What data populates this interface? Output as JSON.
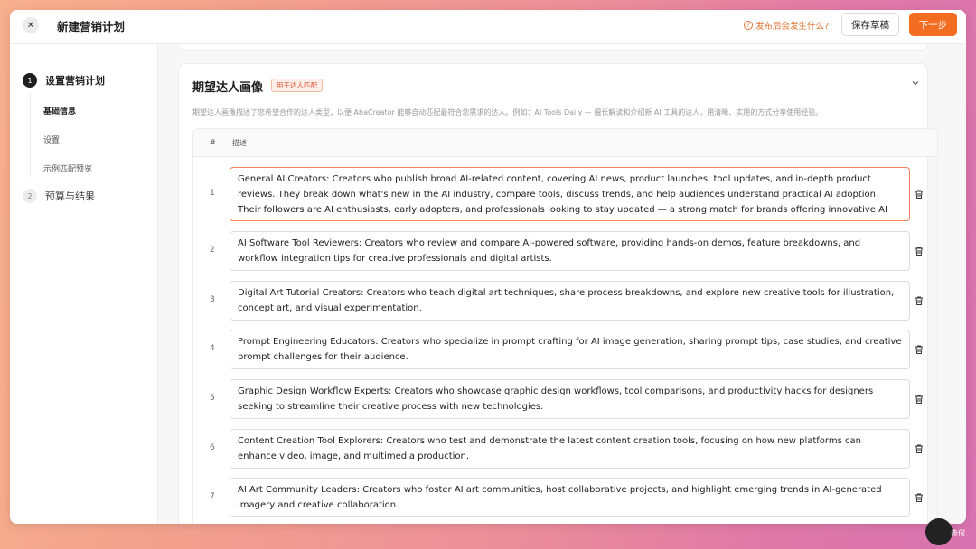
{
  "header": {
    "close_icon": "close-icon",
    "title": "新建营销计划",
    "help_text": "发布后会发生什么?",
    "save_label": "保存草稿",
    "next_label": "下一步",
    "accent_color": "#f26c22"
  },
  "sidebar": {
    "steps": [
      {
        "num": "1",
        "label": "设置营销计划",
        "state": "active"
      },
      {
        "num": "2",
        "label": "预算与结果",
        "state": "inactive"
      }
    ],
    "substeps": [
      {
        "label": "基础信息",
        "current": true
      },
      {
        "label": "设置",
        "current": false
      },
      {
        "label": "示例匹配预览",
        "current": false
      }
    ]
  },
  "section": {
    "title": "期望达人画像",
    "tag": "用于达人匹配",
    "description": "期望达人画像描述了您希望合作的达人类型，以便 AhaCreator 能够自动匹配最符合您需求的达人。例如：AI Tools Daily — 擅长解读和介绍新 AI 工具的达人，用清晰、实用的方式分享使用经验。",
    "table": {
      "col_index": "#",
      "col_desc": "描述",
      "rows": [
        {
          "index": "1",
          "text": "General AI Creators: Creators who publish broad AI-related content, covering AI news, product launches, tool updates, and in-depth product reviews. They break down what's new in the AI industry, compare tools, discuss trends, and help audiences understand practical AI adoption. Their followers are AI enthusiasts, early adopters, and professionals looking to stay updated — a strong match for brands offering innovative AI solutions."
        },
        {
          "index": "2",
          "text": "AI Software Tool Reviewers: Creators who review and compare AI-powered software, providing hands-on demos, feature breakdowns, and workflow integration tips for creative professionals and digital artists."
        },
        {
          "index": "3",
          "text": "Digital Art Tutorial Creators: Creators who teach digital art techniques, share process breakdowns, and explore new creative tools for illustration, concept art, and visual experimentation."
        },
        {
          "index": "4",
          "text": "Prompt Engineering Educators: Creators who specialize in prompt crafting for AI image generation, sharing prompt tips, case studies, and creative prompt challenges for their audience."
        },
        {
          "index": "5",
          "text": "Graphic Design Workflow Experts: Creators who showcase graphic design workflows, tool comparisons, and productivity hacks for designers seeking to streamline their creative process with new technologies."
        },
        {
          "index": "6",
          "text": "Content Creation Tool Explorers: Creators who test and demonstrate the latest content creation tools, focusing on how new platforms can enhance video, image, and multimedia production."
        },
        {
          "index": "7",
          "text": "AI Art Community Leaders: Creators who foster AI art communities, host collaborative projects, and highlight emerging trends in AI-generated imagery and creative collaboration."
        }
      ]
    }
  },
  "watermark": "赤何"
}
